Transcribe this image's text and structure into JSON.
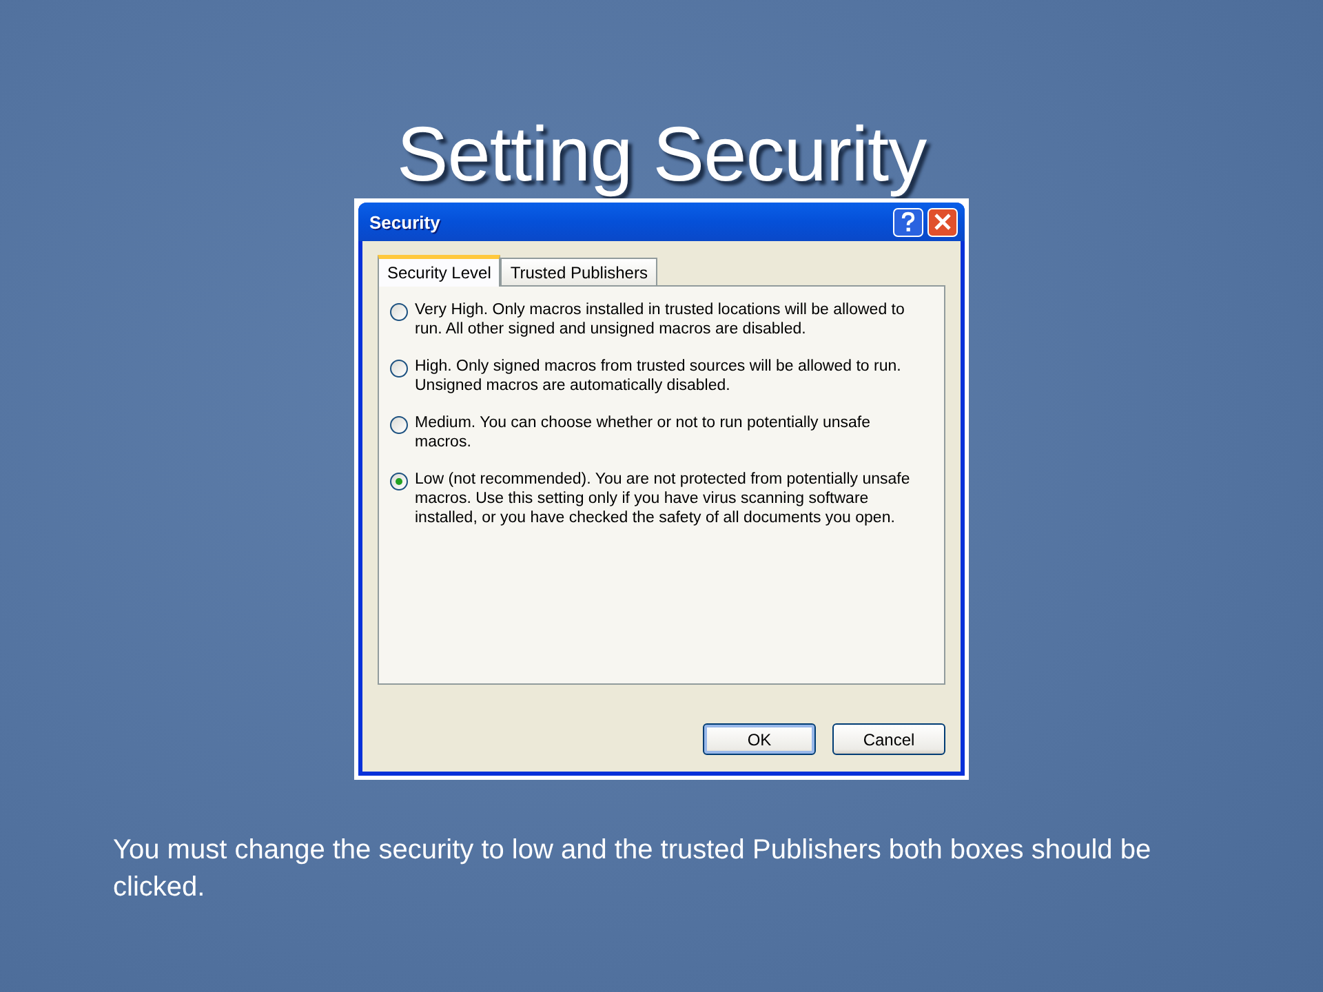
{
  "slide_title": "Setting Security",
  "dialog": {
    "title": "Security",
    "tabs": [
      {
        "label": "Security Level",
        "selected": true
      },
      {
        "label": "Trusted Publishers",
        "selected": false
      }
    ],
    "options": [
      {
        "label": "Very High. Only macros installed in trusted locations will be allowed to run. All other signed and unsigned macros are disabled.",
        "selected": false
      },
      {
        "label": "High. Only signed macros from trusted sources will be allowed to run. Unsigned macros are automatically disabled.",
        "selected": false
      },
      {
        "label": "Medium. You can choose whether or not to run potentially unsafe macros.",
        "selected": false
      },
      {
        "label": "Low (not recommended). You are not protected from potentially unsafe macros. Use this setting only if you have virus scanning software installed, or you have checked the safety of all documents you open.",
        "selected": true
      }
    ],
    "buttons": [
      {
        "label": "OK",
        "default": true
      },
      {
        "label": "Cancel",
        "default": false
      }
    ]
  },
  "caption": "You must change the security to low and the trusted Publishers both boxes should be clicked."
}
